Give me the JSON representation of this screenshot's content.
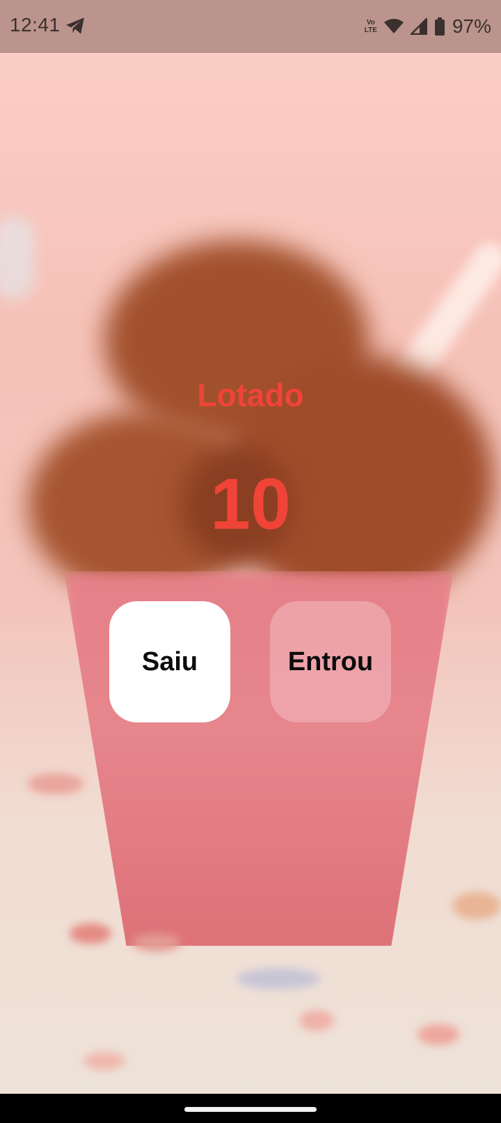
{
  "status_bar": {
    "time": "12:41",
    "network_label_top": "Vo",
    "network_label_bottom": "LTE",
    "battery_percent": "97%"
  },
  "main": {
    "status_text": "Lotado",
    "count": "10",
    "exit_button_label": "Saiu",
    "enter_button_label": "Entrou"
  },
  "colors": {
    "accent": "#ef4437",
    "status_bar_bg": "#bb948d"
  },
  "icons": [
    "telegram-icon",
    "volte-icon",
    "wifi-icon",
    "signal-icon",
    "battery-icon"
  ]
}
